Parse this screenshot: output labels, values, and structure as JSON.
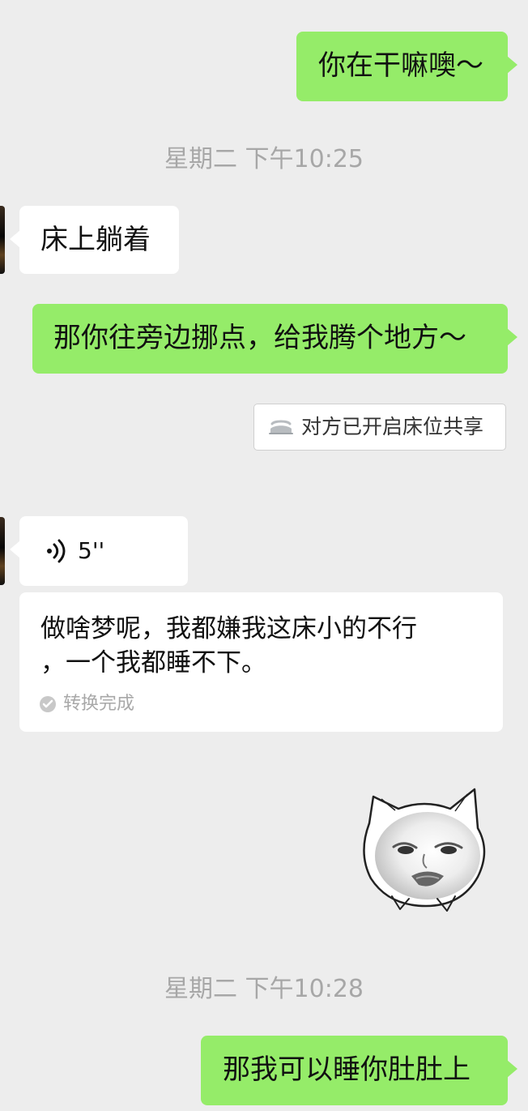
{
  "chat": {
    "messages": [
      {
        "sender": "me",
        "text": "你在干嘛噢～"
      },
      {
        "type": "time",
        "text": "星期二 下午10:25"
      },
      {
        "sender": "other",
        "text": "床上躺着"
      },
      {
        "sender": "me",
        "text": "那你往旁边挪点，给我腾个地方～"
      },
      {
        "type": "system",
        "icon": "bed-icon",
        "text": "对方已开启床位共享"
      },
      {
        "sender": "other",
        "type": "voice",
        "icon": "voice-icon",
        "duration": "5''"
      },
      {
        "sender": "other",
        "type": "transcription",
        "lines": [
          "做啥梦呢，我都嫌我这床小的不行",
          "，一个我都睡不下。"
        ],
        "status_icon": "check-circle-icon",
        "status": "转换完成"
      },
      {
        "sender": "me",
        "type": "sticker",
        "name": "cat-face-sticker"
      },
      {
        "type": "time",
        "text": "星期二 下午10:28"
      },
      {
        "sender": "me",
        "text": "那我可以睡你肚肚上"
      }
    ]
  },
  "colors": {
    "background": "#ededed",
    "my_bubble": "#95ec69",
    "other_bubble": "#ffffff",
    "timestamp": "#a7a7a7"
  }
}
